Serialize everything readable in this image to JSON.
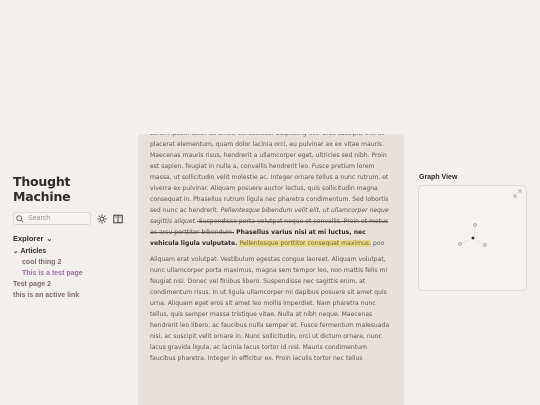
{
  "sidebar": {
    "title_line1": "Thought",
    "title_line2": "Machine",
    "search_placeholder": "Search",
    "explorer_label": "Explorer",
    "tree": {
      "folder": "Articles",
      "children": [
        "cool thing 2",
        "This is a test page"
      ],
      "pages": [
        "Test page 2",
        "this is an active link"
      ]
    }
  },
  "article": {
    "p1": {
      "a": "Lorem ipsum dolor sit amet, consectetur adipiscing elit. Cras suscipit, orci ut placerat elementum, quam dolor lacinia orci, eu pulvinar ex ex vitae mauris. Maecenas mauris risus, hendrerit a ullamcorper eget, ultricies sed nibh. Proin est sapien, feugiat in nulla a, convallis hendrerit leo. Fusce pretium lorem massa, ut sollicitudin velit molestie ac. Integer ornare tellus a nunc rutrum, et viverra ex pulvinar. Aliquam posuere auctor lectus, quis sollicitudin magna consequat in. Phasellus rutrum ligula nec pharetra condimentum. Sed lobortis sed nunc ac hendrerit. ",
      "italic": "Pellentesque bibendum velit elit, ut ullamcorper neque sagittis aliquet.",
      "strike": " Suspendisse porta volutpat neque et convallis. Proin et metus ac arcu porttitor bibendum.",
      "bold": " Phasellus varius nisi at mi luctus, nec vehicula ligula vulputate.",
      "gap": " ",
      "highlight": "Pellentesque porttitor consequat maximus.",
      "tail": " poo"
    },
    "p2": "Aliquam erat volutpat. Vestibulum egestas congue laoreet. Aliquam volutpat, nunc ullamcorper porta maximus, magna sem tempor leo, non mattis felis mi feugiat nisi. Donec vel finibus libero. Suspendisse nec sagittis enim, at condimentum risus. In ut ligula ullamcorper mi dapibus posuere sit amet quis urna. Aliquam eget eros sit amet leo mollis imperdiet. Nam pharetra nunc tellus, quis semper massa tristique vitae. Nulla at nibh neque. Maecenas hendrerit leo libero, ac faucibus nulla semper et. Fusce fermentum malesuada nisi, ac suscipit velit ornare in. Nunc sollicitudin, orci ut dictum ornare, nunc lacus gravida ligula, ac lacinia lacus tortor id nisl. Mauris condimentum faucibus pharetra. Integer in efficitur ex. Proin iaculis tortor nec tellus"
  },
  "graph": {
    "title": "Graph View"
  },
  "colors": {
    "background": "#f3efec",
    "article_background": "#e8e0db",
    "highlight": "#e7d98a",
    "link": "#7c6a73",
    "active_link": "#9e6ea0"
  },
  "icons": [
    "search-icon",
    "sun-icon",
    "book-icon",
    "expand-icon"
  ]
}
